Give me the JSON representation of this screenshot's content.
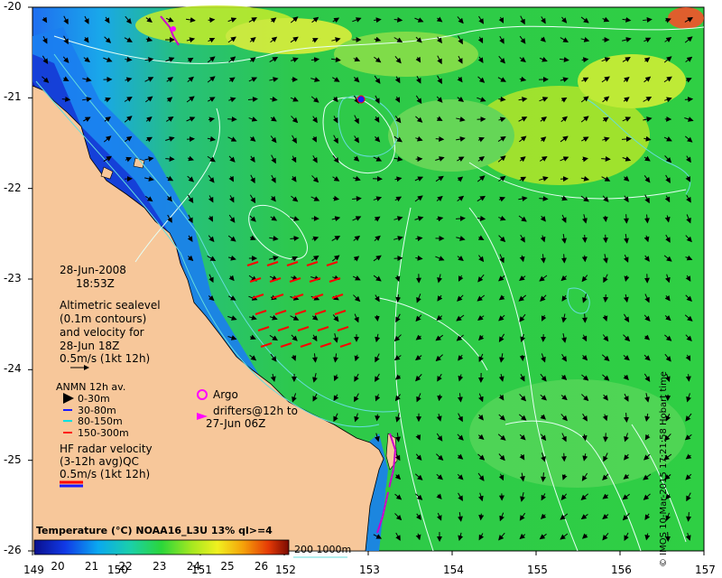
{
  "date_label": "28-Jun-2008",
  "time_label": "18:53Z",
  "altimetry_legend": [
    "Altimetric sealevel",
    "(0.1m contours)",
    "and velocity for",
    "28-Jun 18Z",
    "0.5m/s (1kt 12h)"
  ],
  "anmn": {
    "title": "ANMN 12h av.",
    "items": [
      {
        "label": "0-30m",
        "color": "#000000"
      },
      {
        "label": "30-80m",
        "color": "#1a1aff"
      },
      {
        "label": "80-150m",
        "color": "#00e0e0"
      },
      {
        "label": "150-300m",
        "color": "#ff1a1a"
      }
    ]
  },
  "hf_radar": [
    "HF radar velocity",
    "(3-12h avg)QC",
    "0.5m/s (1kt 12h)"
  ],
  "argo": {
    "label": "Argo",
    "color": "#ff00ff"
  },
  "drifters": {
    "lines": [
      "drifters@12h to",
      "27-Jun 06Z"
    ],
    "color": "#cc00cc"
  },
  "colorbar": {
    "title": "Temperature (°C) NOAA16_L3U 13% ql>=4",
    "ticks": [
      "20",
      "21",
      "22",
      "23",
      "24",
      "25",
      "26"
    ],
    "tick_values": [
      20,
      21,
      22,
      23,
      24,
      25,
      26
    ],
    "range": [
      19.3,
      26.8
    ]
  },
  "isobath_legend": "200  1000m",
  "credit": "© IMOS 10-Mar-2015 17:21:58 Hobart time",
  "axes": {
    "lon_ticks": [
      "149",
      "150",
      "151",
      "152",
      "153",
      "154",
      "155",
      "156",
      "157"
    ],
    "lon_values": [
      149,
      150,
      151,
      152,
      153,
      154,
      155,
      156,
      157
    ],
    "lat_ticks": [
      "-20",
      "-21",
      "-22",
      "-23",
      "-24",
      "-25",
      "-26"
    ],
    "lat_values": [
      -20,
      -21,
      -22,
      -23,
      -24,
      -25,
      -26
    ],
    "lon_range": [
      149,
      157
    ],
    "lat_range": [
      -26,
      -20
    ]
  },
  "colors": {
    "land": "#f7c79a",
    "contour": "#e6fff6",
    "isobath": "#66dddd",
    "arrow": "#000000",
    "mooring_arrow": "#ff0000"
  }
}
